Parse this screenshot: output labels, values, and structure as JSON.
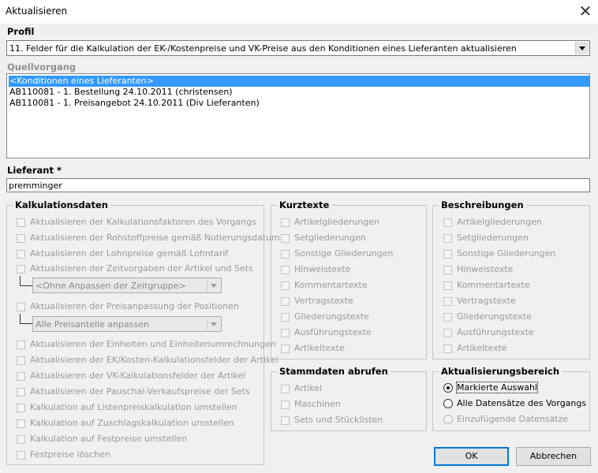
{
  "window": {
    "title": "Aktualisieren"
  },
  "profil": {
    "label": "Profil",
    "value": "11. Felder für die Kalkulation der EK-/Kostenpreise und VK-Preise aus den Konditionen eines Lieferanten aktualisieren"
  },
  "quellvorgang": {
    "label": "Quellvorgang",
    "items": [
      "<Konditionen eines Lieferanten>",
      "AB110081 - 1. Bestellung 24.10.2011 (christensen)",
      "AB110081 - 1. Preisangebot 24.10.2011 (Div Lieferanten)"
    ]
  },
  "lieferant": {
    "label": "Lieferant *",
    "value": "premminger"
  },
  "kalkulationsdaten": {
    "title": "Kalkulationsdaten",
    "items": [
      "Aktualisieren der Kalkulationsfaktoren des Vorgangs",
      "Aktualisieren der Rohstoffpreise gemäß Notierungsdatum",
      "Aktualisieren der Lohnpreise gemäß Lohntarif",
      "Aktualisieren der Zeitvorgaben der Artikel und Sets",
      "Aktualisieren der Preisanpassung der Positionen",
      "Aktualisieren der Einheiten und Einheitenumrechnungen",
      "Aktualisieren der EK/Kosten-Kalkulationsfelder der Artikel",
      "Aktualisieren der VK-Kalkulationsfelder der Artikel",
      "Aktualisieren der Pauschal-Verkaufspreise der Sets",
      "Kalkulation auf Listenpreiskalkulation umstellen",
      "Kalkulation auf Zuschlagskalkulation umstellen",
      "Kalkulation auf Festpreise umstellen",
      "Festpreise löschen"
    ],
    "zeitgruppe_select": "<Ohne Anpassen der Zeitgruppe>",
    "preisanteile_select": "Alle Preisanteile anpassen"
  },
  "kurztexte": {
    "title": "Kurztexte",
    "items": [
      "Artikelgliederungen",
      "Setgliederungen",
      "Sonstige Gliederungen",
      "Hinweistexte",
      "Kommentartexte",
      "Vertragstexte",
      "Gliederungstexte",
      "Ausführungstexte",
      "Artikeltexte"
    ]
  },
  "beschreibungen": {
    "title": "Beschreibungen",
    "items": [
      "Artikelgliederungen",
      "Setgliederungen",
      "Sonstige Gliederungen",
      "Hinweistexte",
      "Kommentartexte",
      "Vertragstexte",
      "Gliederungstexte",
      "Ausführungstexte",
      "Artikeltexte"
    ]
  },
  "stammdaten": {
    "title": "Stammdaten abrufen",
    "items": [
      "Artikel",
      "Maschinen",
      "Sets und Stücklisten"
    ]
  },
  "bereich": {
    "title": "Aktualisierungsbereich",
    "options": [
      "Markierte Auswahl",
      "Alle Datensätze des Vorgangs",
      "Einzufügende Datensätze"
    ],
    "selected": "Markierte Auswahl"
  },
  "buttons": {
    "ok": "OK",
    "cancel": "Abbrechen"
  },
  "colors": {
    "selection": "#3399ff",
    "default_button_border": "#0078d7"
  }
}
